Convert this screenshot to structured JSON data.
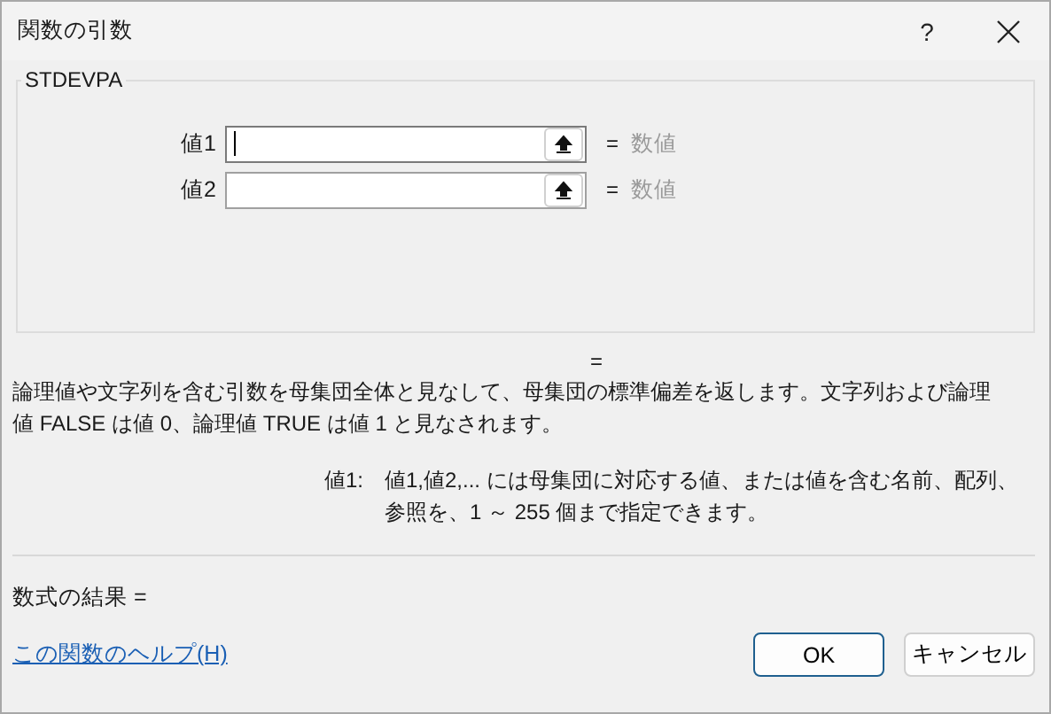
{
  "window": {
    "title": "関数の引数",
    "help_button": "?"
  },
  "function_group": {
    "title": "STDEVPA",
    "arguments": [
      {
        "label": "値1",
        "focused": true,
        "equals": "=",
        "result": "数値"
      },
      {
        "label": "値2",
        "focused": false,
        "equals": "=",
        "result": "数値"
      }
    ]
  },
  "function_result_equals": "=",
  "description": "論理値や文字列を含む引数を母集団全体と見なして、母集団の標準偏差を返します。文字列および論理値 FALSE は値 0、論理値 TRUE は値 1 と見なされます。",
  "argument_help": {
    "label": "値1:",
    "text": "値1,値2,... には母集団に対応する値、または値を含む名前、配列、参照を、1 ～ 255 個まで指定できます。"
  },
  "formula_result": "数式の結果 =",
  "help_link": "この関数のヘルプ(H)",
  "buttons": [
    {
      "label": "OK",
      "kind": "primary"
    },
    {
      "label": "キャンセル",
      "kind": "secondary"
    }
  ]
}
